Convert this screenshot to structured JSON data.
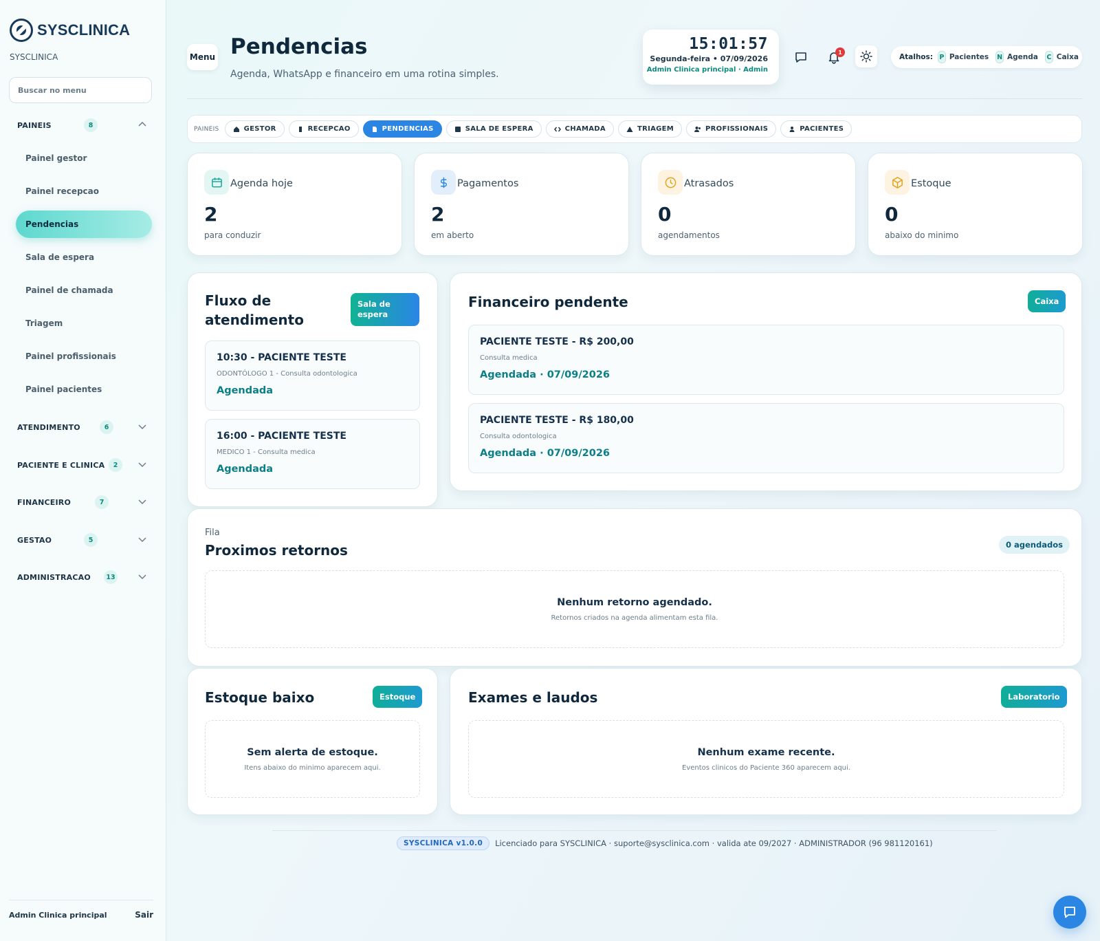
{
  "brand": {
    "name": "SYSCLINICA",
    "org": "SYSCLINICA"
  },
  "sidebar": {
    "search_placeholder": "Buscar no menu",
    "groups": [
      {
        "label": "PAINEIS",
        "count": "8",
        "expanded": true
      },
      {
        "label": "ATENDIMENTO",
        "count": "6"
      },
      {
        "label": "PACIENTE E CLINICA",
        "count": "2"
      },
      {
        "label": "FINANCEIRO",
        "count": "7"
      },
      {
        "label": "GESTAO",
        "count": "5"
      },
      {
        "label": "ADMINISTRACAO",
        "count": "13"
      }
    ],
    "items": [
      "Painel gestor",
      "Painel recepcao",
      "Pendencias",
      "Sala de espera",
      "Painel de chamada",
      "Triagem",
      "Painel profissionais",
      "Painel pacientes"
    ],
    "active_item": "Pendencias",
    "user": "Admin Clinica principal",
    "exit": "Sair"
  },
  "header": {
    "menu_label": "Menu",
    "title": "Pendencias",
    "subtitle": "Agenda, WhatsApp e financeiro em uma rotina simples.",
    "clock": {
      "time": "15:01:57",
      "date": "Segunda-feira • 07/09/2026",
      "user": "Admin Clinica principal · Admin"
    },
    "notifications": "1",
    "shortcuts": {
      "title": "Atalhos:",
      "items": [
        {
          "key": "P",
          "label": "Pacientes"
        },
        {
          "key": "N",
          "label": "Agenda"
        },
        {
          "key": "C",
          "label": "Caixa"
        }
      ]
    }
  },
  "tabs": {
    "label": "PAINEIS",
    "items": [
      "GESTOR",
      "RECEPCAO",
      "PENDENCIAS",
      "SALA DE ESPERA",
      "CHAMADA",
      "TRIAGEM",
      "PROFISSIONAIS",
      "PACIENTES"
    ],
    "active": "PENDENCIAS"
  },
  "stats": [
    {
      "label": "Agenda hoje",
      "value": "2",
      "sub": "para conduzir",
      "icon": "calendar-icon",
      "color": "#12a594"
    },
    {
      "label": "Pagamentos",
      "value": "2",
      "sub": "em aberto",
      "icon": "dollar-icon",
      "color": "#2b86e3"
    },
    {
      "label": "Atrasados",
      "value": "0",
      "sub": "agendamentos",
      "icon": "clock-icon",
      "color": "#e0a11b"
    },
    {
      "label": "Estoque",
      "value": "0",
      "sub": "abaixo do minimo",
      "icon": "box-icon",
      "color": "#e0a11b"
    }
  ],
  "flow": {
    "title": "Fluxo de atendimento",
    "button": "Sala de espera",
    "items": [
      {
        "title": "10:30 - PACIENTE TESTE",
        "sub": "ODONTÓLOGO 1 - Consulta odontologica",
        "status": "Agendada"
      },
      {
        "title": "16:00 - PACIENTE TESTE",
        "sub": "MEDICO 1 - Consulta medica",
        "status": "Agendada"
      }
    ]
  },
  "finance": {
    "title": "Financeiro pendente",
    "button": "Caixa",
    "items": [
      {
        "title": "PACIENTE TESTE - R$ 200,00",
        "sub": "Consulta medica",
        "status": "Agendada · 07/09/2026"
      },
      {
        "title": "PACIENTE TESTE - R$ 180,00",
        "sub": "Consulta odontologica",
        "status": "Agendada · 07/09/2026"
      }
    ]
  },
  "returns": {
    "kicker": "Fila",
    "title": "Proximos retornos",
    "badge": "0 agendados",
    "empty_title": "Nenhum retorno agendado.",
    "empty_sub": "Retornos criados na agenda alimentam esta fila."
  },
  "stock": {
    "title": "Estoque baixo",
    "button": "Estoque",
    "empty_title": "Sem alerta de estoque.",
    "empty_sub": "Itens abaixo do minimo aparecem aqui."
  },
  "exams": {
    "title": "Exames e laudos",
    "button": "Laboratorio",
    "empty_title": "Nenhum exame recente.",
    "empty_sub": "Eventos clinicos do Paciente 360 aparecem aqui."
  },
  "footer": {
    "version": "SYSCLINICA v1.0.0",
    "text": "Licenciado para SYSCLINICA · suporte@sysclinica.com · valida ate 09/2027 · ADMINISTRADOR (96 981120161)"
  }
}
